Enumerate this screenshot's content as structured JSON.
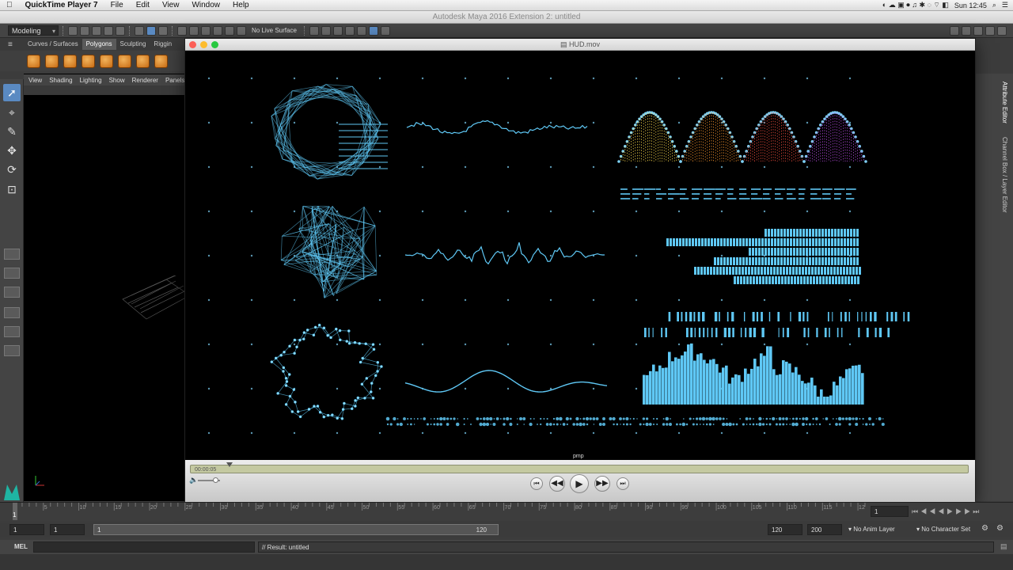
{
  "macmenu": {
    "app": "QuickTime Player 7",
    "items": [
      "File",
      "Edit",
      "View",
      "Window",
      "Help"
    ],
    "clock": "Sun 12:45"
  },
  "maya": {
    "title": "Autodesk Maya 2016 Extension 2: untitled",
    "mode": "Modeling",
    "live_surface": "No Live Surface",
    "shelf_tabs": [
      "Curves / Surfaces",
      "Polygons",
      "Sculpting",
      "Riggin"
    ],
    "active_shelf": "Polygons",
    "viewport_menu": [
      "View",
      "Shading",
      "Lighting",
      "Show",
      "Renderer",
      "Panels"
    ],
    "right_tabs": [
      "Attribute Editor",
      "Channel Box / Layer Editor"
    ],
    "timeline_ticks": [
      "5",
      "10",
      "15",
      "20",
      "25",
      "30",
      "35",
      "40",
      "45",
      "50",
      "55",
      "60",
      "65",
      "70",
      "75",
      "80",
      "85",
      "90",
      "95",
      "100",
      "105",
      "110",
      "115",
      "12"
    ],
    "current_frame": "1",
    "current_frame_field": "1",
    "range_start": "1",
    "range_start2": "1",
    "range_inner_start": "1",
    "range_inner_end": "120",
    "range_end": "120",
    "range_end2": "200",
    "anim_layer": "No Anim Layer",
    "char_set": "No Character Set",
    "mel_label": "MEL",
    "result": "// Result: untitled"
  },
  "quicktime": {
    "title": "HUD.mov",
    "timecode": "00:00:05",
    "progress": 0.05,
    "volume": 0.8,
    "watermark": "pmp"
  },
  "colors": {
    "hud_blue": "#5fc8f5",
    "maya_select": "#5a8ac2"
  }
}
